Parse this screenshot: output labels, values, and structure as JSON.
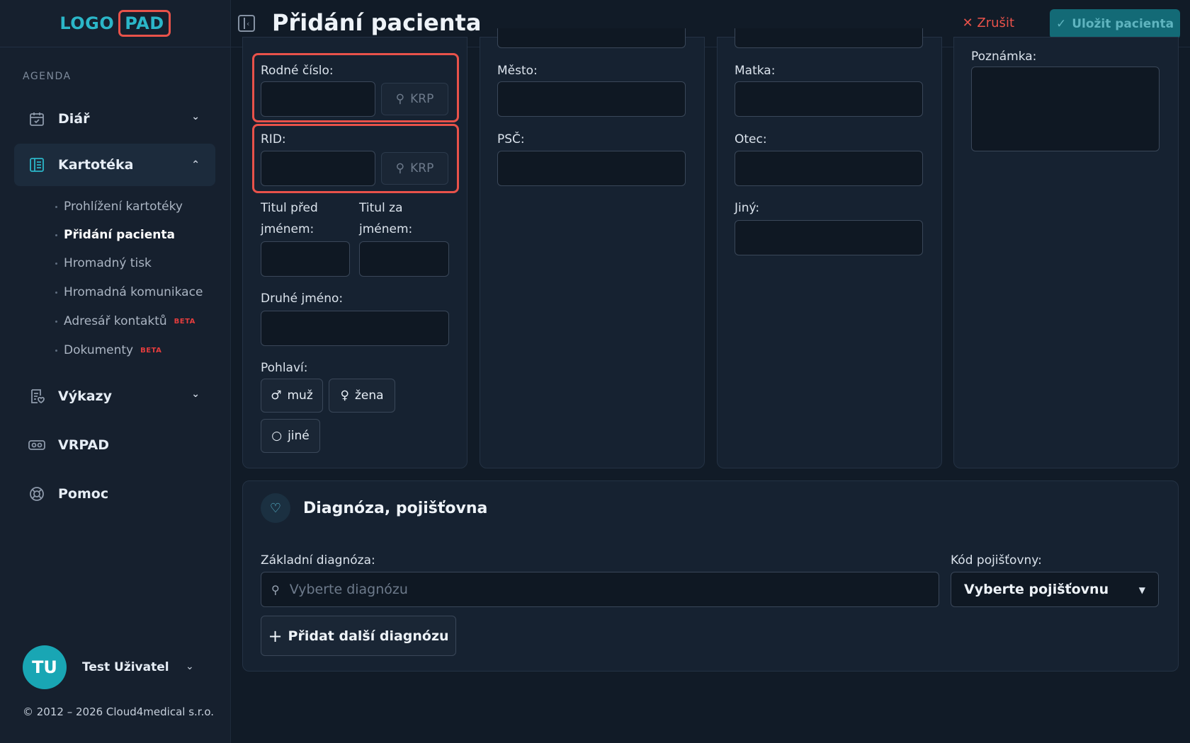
{
  "logo": {
    "part1": "LOGO",
    "part2": "PAD"
  },
  "sidebar": {
    "section_label": "AGENDA",
    "items": [
      {
        "label": "Diář",
        "icon": "calendar-icon"
      },
      {
        "label": "Kartotéka",
        "icon": "book-icon"
      },
      {
        "label": "Výkazy",
        "icon": "report-icon"
      },
      {
        "label": "VRPAD",
        "icon": "vr-headset-icon"
      },
      {
        "label": "Pomoc",
        "icon": "lifebuoy-icon"
      }
    ],
    "subitems": [
      {
        "label": "Prohlížení kartotéky"
      },
      {
        "label": "Přidání pacienta"
      },
      {
        "label": "Hromadný tisk"
      },
      {
        "label": "Hromadná komunikace"
      },
      {
        "label": "Adresář kontaktů",
        "badge": "BETA"
      },
      {
        "label": "Dokumenty",
        "badge": "BETA"
      }
    ],
    "user": {
      "initials": "TU",
      "name": "Test Uživatel"
    },
    "copyright": "© 2012 – 2026 Cloud4medical s.r.o."
  },
  "header": {
    "title": "Přidání pacienta",
    "cancel_label": "Zrušit",
    "save_label": "Uložit pacienta"
  },
  "form": {
    "rodne_cislo_label": "Rodné číslo:",
    "rid_label": "RID:",
    "krp_label": "KRP",
    "titul_pred_label_1": "Titul před",
    "titul_pred_label_2": "jménem:",
    "titul_za_label_1": "Titul za",
    "titul_za_label_2": "jménem:",
    "druhe_jmeno_label": "Druhé jméno:",
    "pohlavi_label": "Pohlaví:",
    "gender_options": [
      "muž",
      "žena",
      "jiné"
    ],
    "mesto_label": "Město:",
    "psc_label": "PSČ:",
    "matka_label": "Matka:",
    "otec_label": "Otec:",
    "jiny_label": "Jiný:",
    "poznamka_label": "Poznámka:"
  },
  "diagnosis": {
    "title": "Diagnóza, pojišťovna",
    "base_label": "Základní diagnóza:",
    "base_placeholder": "Vyberte diagnózu",
    "insurer_label": "Kód pojišťovny:",
    "insurer_value": "Vyberte pojišťovnu",
    "add_label": "Přidat další diagnózu"
  },
  "colors": {
    "accent": "#2bb6c8",
    "danger": "#e8524a",
    "background": "#111b27",
    "sidebar": "#16202e",
    "card": "#162231"
  }
}
